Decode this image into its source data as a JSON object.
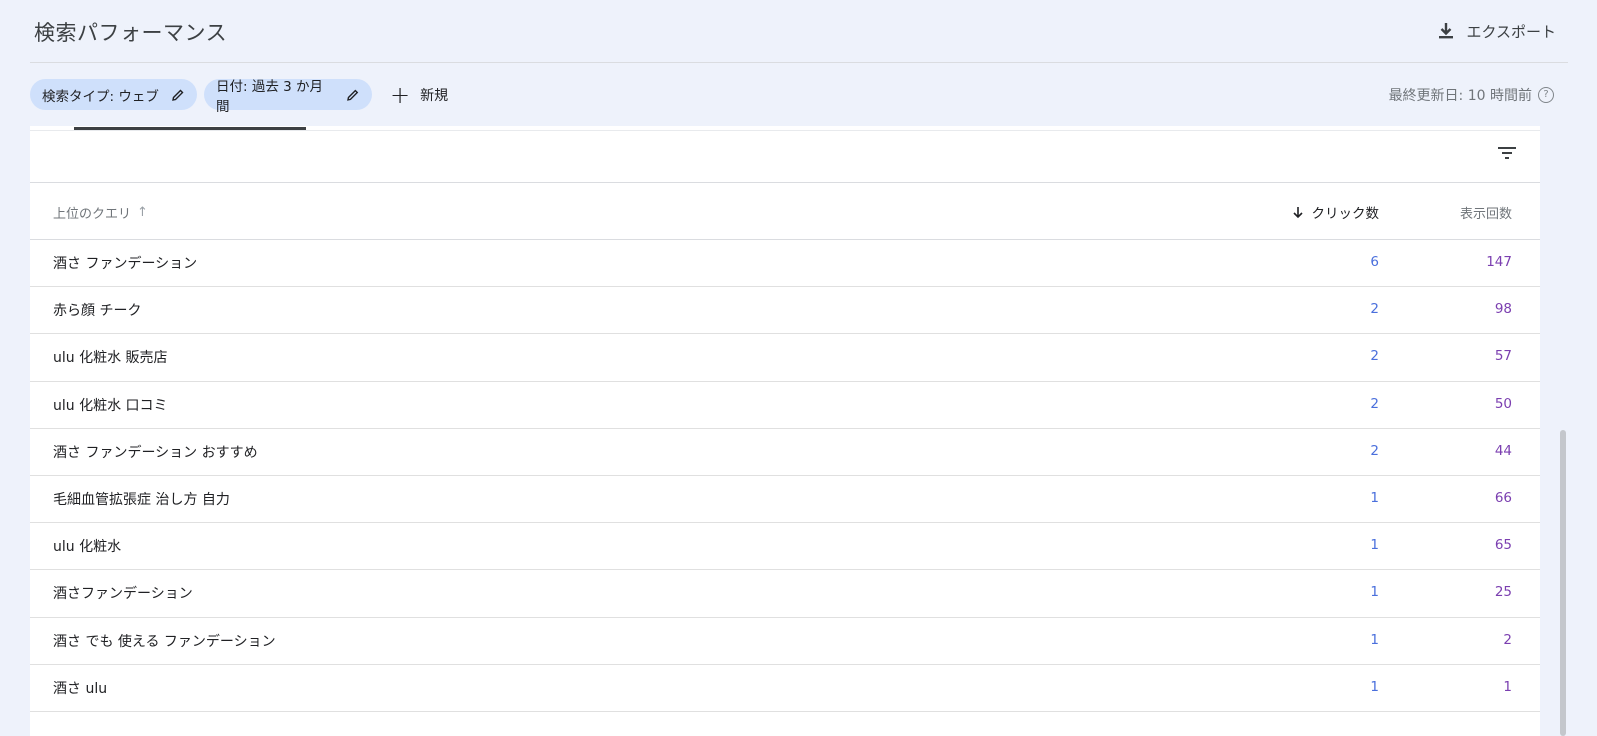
{
  "header": {
    "title": "検索パフォーマンス",
    "export_label": "エクスポート"
  },
  "filters": {
    "search_type_chip": "検索タイプ: ウェブ",
    "date_chip": "日付: 過去 3 か月間",
    "new_label": "新規",
    "last_updated": "最終更新日: 10 時間前"
  },
  "table": {
    "columns": {
      "query": "上位のクエリ",
      "clicks": "クリック数",
      "impressions": "表示回数"
    },
    "rows": [
      {
        "query": "酒さ ファンデーション",
        "clicks": "6",
        "impressions": "147"
      },
      {
        "query": "赤ら顔 チーク",
        "clicks": "2",
        "impressions": "98"
      },
      {
        "query": "ulu 化粧水 販売店",
        "clicks": "2",
        "impressions": "57"
      },
      {
        "query": "ulu 化粧水 口コミ",
        "clicks": "2",
        "impressions": "50"
      },
      {
        "query": "酒さ ファンデーション おすすめ",
        "clicks": "2",
        "impressions": "44"
      },
      {
        "query": "毛細血管拡張症 治し方 自力",
        "clicks": "1",
        "impressions": "66"
      },
      {
        "query": "ulu 化粧水",
        "clicks": "1",
        "impressions": "65"
      },
      {
        "query": "酒さファンデーション",
        "clicks": "1",
        "impressions": "25"
      },
      {
        "query": "酒さ でも 使える ファンデーション",
        "clicks": "1",
        "impressions": "2"
      },
      {
        "query": "酒さ ulu",
        "clicks": "1",
        "impressions": "1"
      }
    ]
  },
  "icons": {
    "export": "download-icon",
    "edit": "pencil-icon",
    "add": "plus-icon",
    "help": "help-circle-icon",
    "filter": "filter-list-icon",
    "sort": "arrow-down-icon"
  },
  "colors": {
    "background": "#eef2fb",
    "chip": "#cfe0fb",
    "clicks": "#4a6fdc",
    "impressions": "#7b3fb0"
  }
}
